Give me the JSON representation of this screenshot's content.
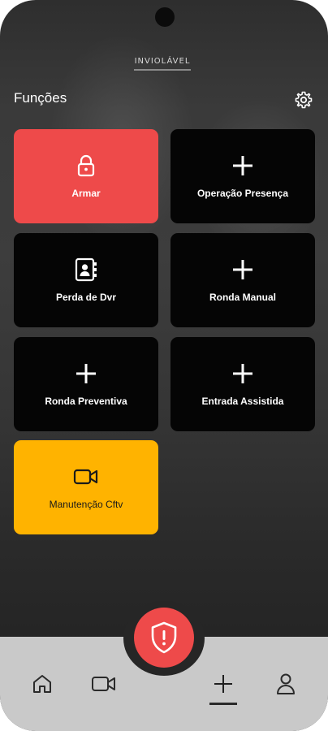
{
  "header": {
    "logo_text": "INVIOLÁVEL",
    "title": "Funções",
    "settings_icon": "gear-icon"
  },
  "tiles": [
    {
      "label": "Armar",
      "icon": "lock-icon",
      "color": "#ee4a4a"
    },
    {
      "label": "Operação Presença",
      "icon": "plus-icon",
      "color": "#050505"
    },
    {
      "label": "Perda de Dvr",
      "icon": "contacts-book-icon",
      "color": "#050505"
    },
    {
      "label": "Ronda Manual",
      "icon": "plus-icon",
      "color": "#050505"
    },
    {
      "label": "Ronda Preventiva",
      "icon": "plus-icon",
      "color": "#050505"
    },
    {
      "label": "Entrada Assistida",
      "icon": "plus-icon",
      "color": "#050505"
    },
    {
      "label": "Manutenção Cftv",
      "icon": "video-camera-icon",
      "color": "#ffb300"
    }
  ],
  "bottom_nav": {
    "fab_icon": "shield-alert-icon",
    "items": [
      {
        "icon": "home-icon"
      },
      {
        "icon": "video-camera-icon"
      },
      {
        "icon": "plus-icon",
        "active": true
      },
      {
        "icon": "user-icon"
      }
    ]
  },
  "colors": {
    "accent_red": "#ee4a4a",
    "accent_yellow": "#ffb300",
    "tile_dark": "#050505",
    "bottom_bar": "#c9c9c9"
  }
}
